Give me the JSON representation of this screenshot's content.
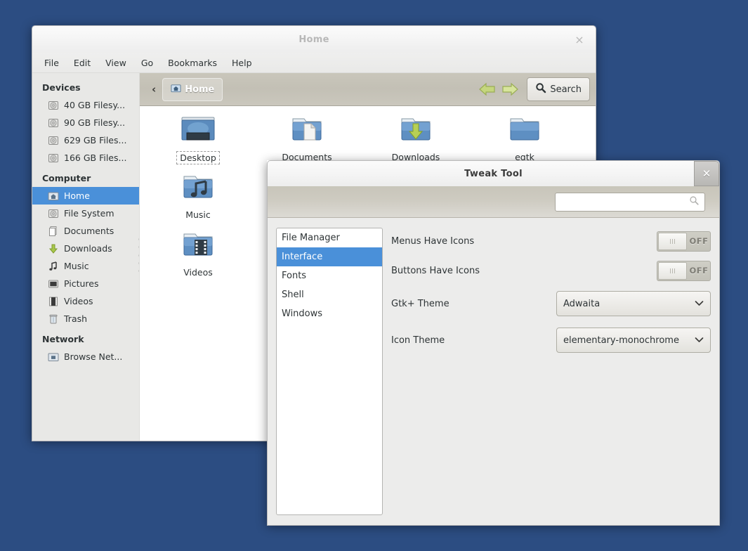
{
  "desktop": {
    "name": "desktop-wallpaper"
  },
  "file_manager": {
    "title": "Home",
    "close_glyph": "×",
    "menubar": [
      "File",
      "Edit",
      "View",
      "Go",
      "Bookmarks",
      "Help"
    ],
    "toolbar": {
      "back_chevron": "‹",
      "breadcrumb": "Home",
      "back_arrow_name": "back-arrow",
      "forward_arrow_name": "forward-arrow",
      "search_label": "Search"
    },
    "sidebar": {
      "groups": [
        {
          "heading": "Devices",
          "items": [
            {
              "label": "40 GB Filesy...",
              "icon": "drive-icon",
              "selected": false
            },
            {
              "label": "90 GB Filesy...",
              "icon": "drive-icon",
              "selected": false
            },
            {
              "label": "629 GB Files...",
              "icon": "drive-icon",
              "selected": false
            },
            {
              "label": "166 GB Files...",
              "icon": "drive-icon",
              "selected": false
            }
          ]
        },
        {
          "heading": "Computer",
          "items": [
            {
              "label": "Home",
              "icon": "home-folder-icon",
              "selected": true
            },
            {
              "label": "File System",
              "icon": "drive-icon",
              "selected": false
            },
            {
              "label": "Documents",
              "icon": "documents-icon",
              "selected": false
            },
            {
              "label": "Downloads",
              "icon": "download-arrow-icon",
              "selected": false
            },
            {
              "label": "Music",
              "icon": "music-note-icon",
              "selected": false
            },
            {
              "label": "Pictures",
              "icon": "picture-icon",
              "selected": false
            },
            {
              "label": "Videos",
              "icon": "film-icon",
              "selected": false
            },
            {
              "label": "Trash",
              "icon": "trash-icon",
              "selected": false
            }
          ]
        },
        {
          "heading": "Network",
          "items": [
            {
              "label": "Browse Net...",
              "icon": "network-folder-icon",
              "selected": false
            }
          ]
        }
      ]
    },
    "files": [
      {
        "name": "Desktop",
        "icon": "desktop-folder-icon",
        "selected": true
      },
      {
        "name": "Documents",
        "icon": "documents-folder-icon",
        "selected": false
      },
      {
        "name": "Downloads",
        "icon": "downloads-folder-icon",
        "selected": false
      },
      {
        "name": "egtk",
        "icon": "plain-folder-icon",
        "selected": false
      },
      {
        "name": "Music",
        "icon": "music-folder-icon",
        "selected": false
      },
      {
        "name": "Videos",
        "icon": "videos-folder-icon",
        "selected": false
      }
    ]
  },
  "tweak_tool": {
    "title": "Tweak Tool",
    "close_glyph": "✕",
    "search": {
      "value": "",
      "placeholder": ""
    },
    "categories": [
      {
        "label": "File Manager",
        "selected": false
      },
      {
        "label": "Interface",
        "selected": true
      },
      {
        "label": "Fonts",
        "selected": false
      },
      {
        "label": "Shell",
        "selected": false
      },
      {
        "label": "Windows",
        "selected": false
      }
    ],
    "settings": [
      {
        "type": "toggle",
        "label": "Menus Have Icons",
        "state": "OFF"
      },
      {
        "type": "toggle",
        "label": "Buttons Have Icons",
        "state": "OFF"
      },
      {
        "type": "combo",
        "label": "Gtk+ Theme",
        "value": "Adwaita",
        "arrow": "⌄"
      },
      {
        "type": "combo",
        "label": "Icon Theme",
        "value": "elementary-monochrome",
        "arrow": "⌄"
      }
    ]
  },
  "colors": {
    "selection_blue": "#4a90d9",
    "desktop_blue": "#4269a4",
    "toolbar_tan": "#c6c3b8"
  }
}
